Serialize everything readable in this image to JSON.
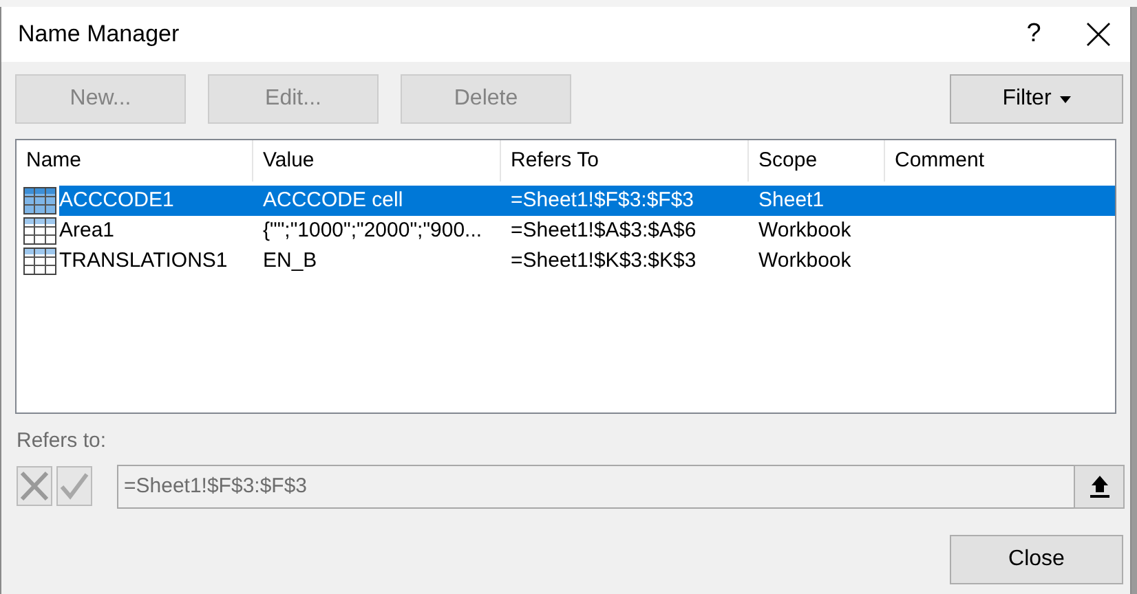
{
  "window": {
    "title": "Name Manager",
    "help": "?"
  },
  "buttons": [
    {
      "label": "New...",
      "disabled": true
    },
    {
      "label": "Edit...",
      "disabled": true
    },
    {
      "label": "Delete",
      "disabled": true
    }
  ],
  "filter": {
    "label": "Filter"
  },
  "table": {
    "columns": [
      "Name",
      "Value",
      "Refers To",
      "Scope",
      "Comment"
    ],
    "rows": [
      {
        "name": "ACCCODE1",
        "value": "ACCCODE cell",
        "refers_to": "=Sheet1!$F$3:$F$3",
        "scope": "Sheet1",
        "selected": true
      },
      {
        "name": "Area1",
        "value": "{\"\";\"1000\";\"2000\";\"900...",
        "refers_to": "=Sheet1!$A$3:$A$6",
        "scope": "Workbook",
        "selected": false
      },
      {
        "name": "TRANSLATIONS1",
        "value": "EN_B",
        "refers_to": "=Sheet1!$K$3:$K$3",
        "scope": "Workbook",
        "selected": false
      }
    ]
  },
  "refers_to": {
    "label": "Refers to:",
    "value": "=Sheet1!$F$3:$F$3"
  },
  "close": {
    "label": "Close"
  }
}
